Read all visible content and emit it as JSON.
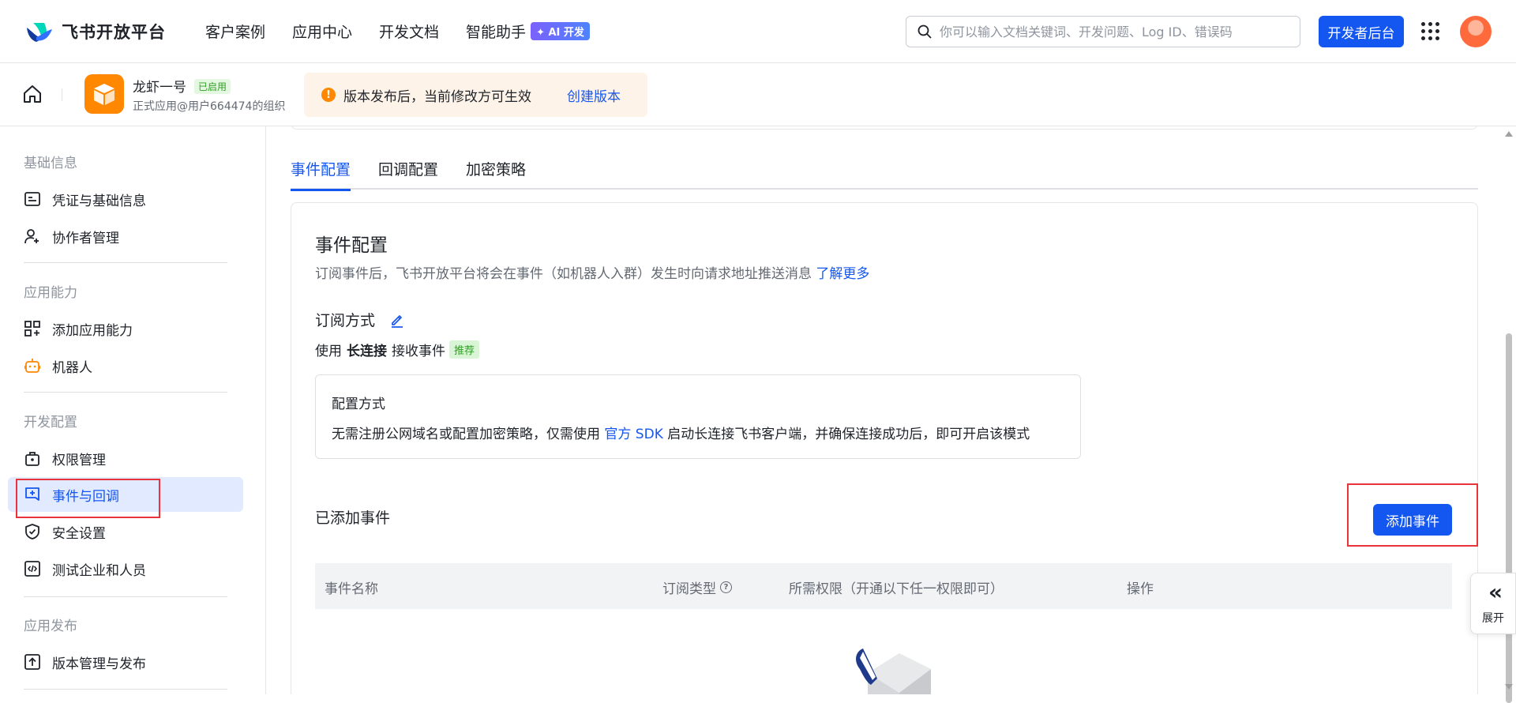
{
  "topnav": {
    "logo_text": "飞书开放平台",
    "items": [
      "客户案例",
      "应用中心",
      "开发文档",
      "智能助手"
    ],
    "ai_badge": "✦ AI 开发",
    "search_placeholder": "你可以输入文档关键词、开发问题、Log ID、错误码",
    "dev_button": "开发者后台"
  },
  "subhead": {
    "app_name": "龙虾一号",
    "status_badge": "已启用",
    "app_sub": "正式应用@用户664474的组织",
    "notice_text": "版本发布后，当前修改方可生效",
    "notice_link": "创建版本"
  },
  "sidebar": {
    "sections": [
      {
        "title": "基础信息",
        "items": [
          "凭证与基础信息",
          "协作者管理"
        ]
      },
      {
        "title": "应用能力",
        "items": [
          "添加应用能力",
          "机器人"
        ]
      },
      {
        "title": "开发配置",
        "items": [
          "权限管理",
          "事件与回调",
          "安全设置",
          "测试企业和人员"
        ]
      },
      {
        "title": "应用发布",
        "items": [
          "版本管理与发布"
        ]
      }
    ],
    "active_item": "事件与回调"
  },
  "tabs": [
    "事件配置",
    "回调配置",
    "加密策略"
  ],
  "event_config": {
    "title": "事件配置",
    "desc": "订阅事件后，飞书开放平台将会在事件（如机器人入群）发生时向请求地址推送消息",
    "desc_link": "了解更多",
    "subscribe_title": "订阅方式",
    "mode_prefix": "使用",
    "mode_bold": "长连接",
    "mode_suffix": "接收事件",
    "mode_badge": "推荐",
    "config_title": "配置方式",
    "config_text_pre": "无需注册公网域名或配置加密策略，仅需使用",
    "config_link": "官方 SDK",
    "config_text_post": "启动长连接飞书客户端，并确保连接成功后，即可开启该模式",
    "added_title": "已添加事件",
    "add_button": "添加事件",
    "table_headers": [
      "事件名称",
      "订阅类型",
      "所需权限（开通以下任一权限即可）",
      "操作"
    ]
  },
  "expand": {
    "icon": "«",
    "label": "展开"
  },
  "colors": {
    "accent": "#1456f0",
    "warning": "#ff8800",
    "highlight": "#e8333a"
  }
}
